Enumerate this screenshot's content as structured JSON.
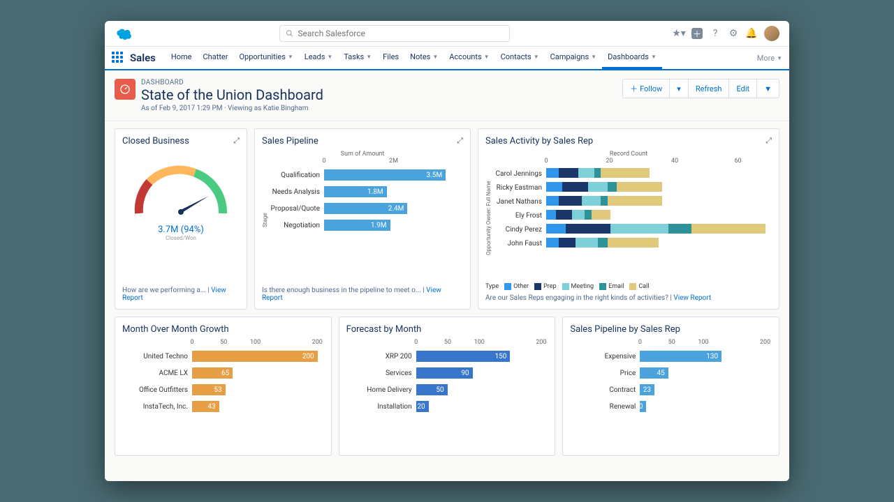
{
  "search": {
    "placeholder": "Search Salesforce"
  },
  "appname": "Sales",
  "nav": [
    "Home",
    "Chatter",
    "Opportunities",
    "Leads",
    "Tasks",
    "Files",
    "Notes",
    "Accounts",
    "Contacts",
    "Campaigns",
    "Dashboards"
  ],
  "nav_dropdown": [
    false,
    false,
    true,
    true,
    true,
    false,
    true,
    true,
    true,
    true,
    true
  ],
  "nav_active": 10,
  "more": "More",
  "header": {
    "kicker": "DASHBOARD",
    "title": "State of the Union Dashboard",
    "sub": "As of Feb 9, 2017 1:29 PM · Viewing as Katie Bingham",
    "follow": "Follow",
    "refresh": "Refresh",
    "edit": "Edit"
  },
  "cards": {
    "closed": {
      "title": "Closed Business",
      "value": "3.7M (94%)",
      "sub": "Closed/Won",
      "foot": "How are we performing a...",
      "link": "View Report"
    },
    "pipeline": {
      "title": "Sales Pipeline",
      "xlabel": "Sum of Amount",
      "ylabel": "Stage",
      "foot": "Is there enough business in the pipeline to meet o...",
      "link": "View Report"
    },
    "activity": {
      "title": "Sales Activity by Sales Rep",
      "xlabel": "Record Count",
      "ylabel": "Opportunity Owner: Full Name",
      "leglabel": "Type",
      "foot": "Are our Sales Reps engaging in the right kinds of activities?",
      "link": "View Report"
    },
    "mom": {
      "title": "Month Over Month Growth"
    },
    "forecast": {
      "title": "Forecast by Month"
    },
    "byrep": {
      "title": "Sales Pipeline by Sales Rep"
    }
  },
  "chart_data": [
    {
      "id": "closed",
      "type": "gauge",
      "value": 3.7,
      "unit": "M",
      "percent": 94,
      "min": 0,
      "max": 4,
      "segments": [
        {
          "color": "#c23934",
          "to": 1
        },
        {
          "color": "#ffb75d",
          "to": 2.5
        },
        {
          "color": "#4bca81",
          "to": 4
        }
      ]
    },
    {
      "id": "pipeline",
      "type": "bar",
      "orientation": "horizontal",
      "xlabel": "Sum of Amount",
      "ylabel": "Stage",
      "xticks": [
        "0",
        "2M"
      ],
      "xmax": 4,
      "categories": [
        "Qualification",
        "Needs Analysis",
        "Proposal/Quote",
        "Negotiation"
      ],
      "values": [
        3.5,
        1.8,
        2.4,
        1.9
      ],
      "labels": [
        "3.5M",
        "1.8M",
        "2.4M",
        "1.9M"
      ],
      "color": "#4ba3dd"
    },
    {
      "id": "activity",
      "type": "stacked-bar",
      "orientation": "horizontal",
      "xlabel": "Record Count",
      "ylabel": "Opportunity Owner: Full Name",
      "xticks": [
        0,
        20,
        40,
        60
      ],
      "xmax": 70,
      "categories": [
        "Carol Jennings",
        "Ricky Eastman",
        "Janet Nathans",
        "Ely Frost",
        "Cindy Perez",
        "John Faust"
      ],
      "series": [
        {
          "name": "Other",
          "color": "#3296ed"
        },
        {
          "name": "Prep",
          "color": "#1b3668"
        },
        {
          "name": "Meeting",
          "color": "#7dcfd8"
        },
        {
          "name": "Email",
          "color": "#2e9398"
        },
        {
          "name": "Call",
          "color": "#e0c97a"
        }
      ],
      "data": [
        [
          4,
          6,
          5,
          2,
          15
        ],
        [
          5,
          8,
          6,
          3,
          14
        ],
        [
          4,
          7,
          6,
          2,
          17
        ],
        [
          3,
          5,
          4,
          2,
          6
        ],
        [
          6,
          14,
          18,
          7,
          23
        ],
        [
          4,
          5,
          7,
          3,
          16
        ]
      ]
    },
    {
      "id": "mom",
      "type": "bar",
      "orientation": "horizontal",
      "xticks": [
        0,
        50,
        100,
        200
      ],
      "xmax": 210,
      "categories": [
        "United Techno",
        "ACME LX",
        "Office Outfitters",
        "InstaTech, Inc."
      ],
      "values": [
        200,
        65,
        53,
        43
      ],
      "color": "#e69f45"
    },
    {
      "id": "forecast",
      "type": "bar",
      "orientation": "horizontal",
      "xticks": [
        0,
        50,
        100,
        200
      ],
      "xmax": 210,
      "categories": [
        "XRP 200",
        "Services",
        "Home Delivery",
        "Installation"
      ],
      "values": [
        150,
        90,
        50,
        20
      ],
      "color": "#3876cc"
    },
    {
      "id": "byrep",
      "type": "bar",
      "orientation": "horizontal",
      "xticks": [
        0,
        50,
        100,
        200
      ],
      "xmax": 210,
      "categories": [
        "Expensive",
        "Price",
        "Contract",
        "Renewal"
      ],
      "values": [
        130,
        45,
        23,
        10
      ],
      "color": "#4ba3dd"
    }
  ],
  "legend": [
    "Other",
    "Prep",
    "Meeting",
    "Email",
    "Call"
  ]
}
